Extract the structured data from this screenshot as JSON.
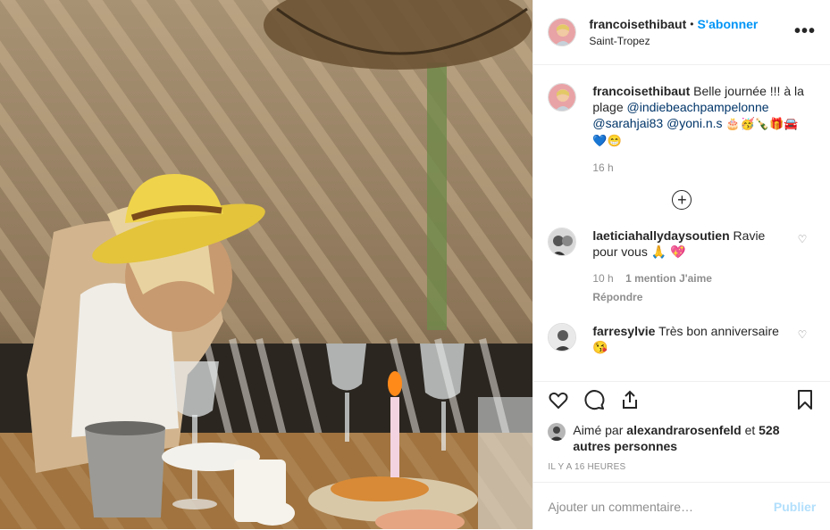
{
  "photo": {
    "alt": ""
  },
  "header": {
    "username": "francoisethibaut",
    "separator": "•",
    "follow_label": "S'abonner",
    "location": "Saint-Tropez",
    "more_label": "•••"
  },
  "caption": {
    "username": "francoisethibaut",
    "text": "Belle journée !!! à la plage",
    "mentions": [
      "@indiebeachpampelonne",
      "@sarahjai83",
      "@yoni.n.s"
    ],
    "emoji_line1": "🎂🥳🍾🎁🚘",
    "emoji_line2": "💙😁",
    "time": "16 h"
  },
  "load_more_label": "+",
  "comments": [
    {
      "username": "laeticiahallydaysoutien",
      "text": "Ravie pour vous 🙏 💖",
      "time": "10 h",
      "likes": "1 mention J'aime",
      "reply": "Répondre"
    },
    {
      "username": "farresylvie",
      "text": "Très bon anniversaire 😘"
    }
  ],
  "likes": {
    "prefix": "Aimé par",
    "user": "alexandrarosenfeld",
    "conj": "et",
    "others": "528 autres personnes"
  },
  "time_ago": "IL Y A 16 HEURES",
  "add_comment": {
    "placeholder": "Ajouter un commentaire…",
    "publish_label": "Publier"
  },
  "icons": {
    "like": "heart-icon",
    "comment": "comment-icon",
    "share": "share-icon",
    "save": "bookmark-icon",
    "more": "more-options-icon",
    "load_more": "plus-circle-icon"
  },
  "colors": {
    "accent": "#0095f6",
    "mention": "#003569",
    "muted": "#8e8e8e",
    "publish_disabled": "#b2dffc"
  }
}
